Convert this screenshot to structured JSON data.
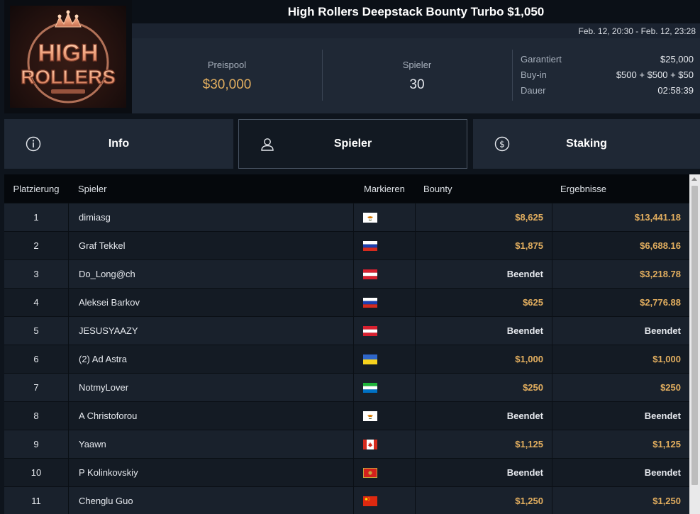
{
  "tournament": {
    "title": "High Rollers Deepstack Bounty Turbo $1,050",
    "dates": "Feb. 12, 20:30 - Feb. 12, 23:28",
    "logo_text_top": "HIGH",
    "logo_text_bottom": "ROLLERS"
  },
  "stats": {
    "prize_pool_label": "Preispool",
    "prize_pool_value": "$30,000",
    "players_label": "Spieler",
    "players_value": "30",
    "guaranteed_label": "Garantiert",
    "guaranteed_value": "$25,000",
    "buyin_label": "Buy-in",
    "buyin_value": "$500 + $500 + $50",
    "duration_label": "Dauer",
    "duration_value": "02:58:39"
  },
  "tabs": {
    "info": "Info",
    "players": "Spieler",
    "staking": "Staking"
  },
  "table": {
    "headers": {
      "rank": "Platzierung",
      "player": "Spieler",
      "mark": "Markieren",
      "bounty": "Bounty",
      "results": "Ergebnisse"
    },
    "rows": [
      {
        "rank": "1",
        "name": "dimiasg",
        "flag": "cy",
        "bounty": "$8,625",
        "result": "$13,441.18"
      },
      {
        "rank": "2",
        "name": "Graf Tekkel",
        "flag": "ru",
        "bounty": "$1,875",
        "result": "$6,688.16"
      },
      {
        "rank": "3",
        "name": "Do_Long@ch",
        "flag": "at",
        "bounty": "Beendet",
        "result": "$3,218.78"
      },
      {
        "rank": "4",
        "name": "Aleksei Barkov",
        "flag": "ru",
        "bounty": "$625",
        "result": "$2,776.88"
      },
      {
        "rank": "5",
        "name": "JESUSYAAZY",
        "flag": "at",
        "bounty": "Beendet",
        "result": "Beendet"
      },
      {
        "rank": "6",
        "name": "(2) Ad Astra",
        "flag": "ua",
        "bounty": "$1,000",
        "result": "$1,000"
      },
      {
        "rank": "7",
        "name": "NotmyLover",
        "flag": "sl",
        "bounty": "$250",
        "result": "$250"
      },
      {
        "rank": "8",
        "name": "A Christoforou",
        "flag": "cy",
        "bounty": "Beendet",
        "result": "Beendet"
      },
      {
        "rank": "9",
        "name": "Yaawn",
        "flag": "ca",
        "bounty": "$1,125",
        "result": "$1,125"
      },
      {
        "rank": "10",
        "name": "P Kolinkovskiy",
        "flag": "me",
        "bounty": "Beendet",
        "result": "Beendet"
      },
      {
        "rank": "11",
        "name": "Chenglu Guo",
        "flag": "cn",
        "bounty": "$1,250",
        "result": "$1,250"
      }
    ]
  },
  "colors": {
    "gold": "#e2ae5f",
    "background": "#0e141c",
    "panel": "#1f2835"
  }
}
